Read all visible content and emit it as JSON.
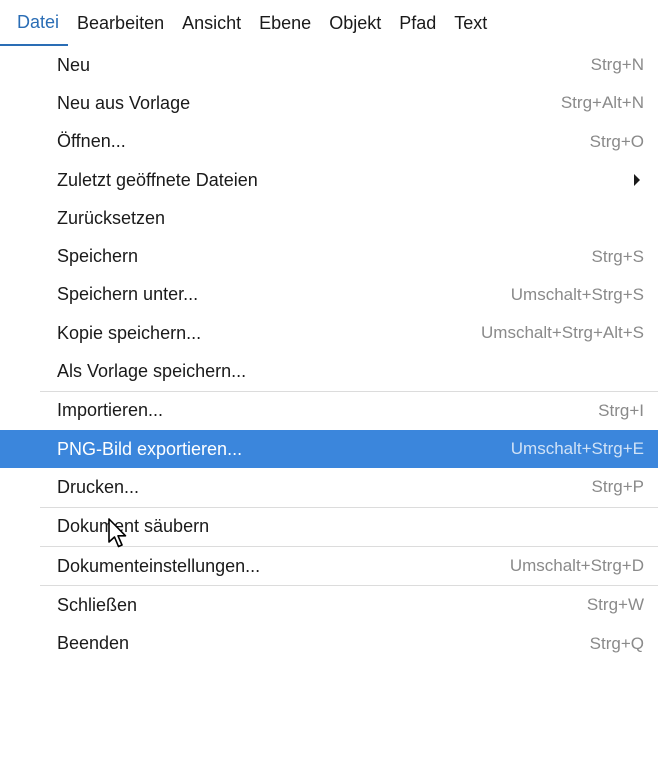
{
  "menubar": {
    "items": [
      {
        "label": "Datei",
        "active": true
      },
      {
        "label": "Bearbeiten"
      },
      {
        "label": "Ansicht"
      },
      {
        "label": "Ebene"
      },
      {
        "label": "Objekt"
      },
      {
        "label": "Pfad"
      },
      {
        "label": "Text"
      }
    ]
  },
  "menu": {
    "items": [
      {
        "label": "Neu",
        "shortcut": "Strg+N"
      },
      {
        "label": "Neu aus Vorlage",
        "shortcut": "Strg+Alt+N"
      },
      {
        "label": "Öffnen...",
        "shortcut": "Strg+O"
      },
      {
        "label": "Zuletzt geöffnete Dateien",
        "submenu": true
      },
      {
        "label": "Zurücksetzen",
        "shortcut": ""
      },
      {
        "label": "Speichern",
        "shortcut": "Strg+S"
      },
      {
        "label": "Speichern unter...",
        "shortcut": "Umschalt+Strg+S"
      },
      {
        "label": "Kopie speichern...",
        "shortcut": "Umschalt+Strg+Alt+S"
      },
      {
        "label": "Als Vorlage speichern...",
        "shortcut": ""
      },
      {
        "label": "Importieren...",
        "shortcut": "Strg+I"
      },
      {
        "label": "PNG-Bild exportieren...",
        "shortcut": "Umschalt+Strg+E",
        "highlighted": true
      },
      {
        "label": "Drucken...",
        "shortcut": "Strg+P"
      },
      {
        "label": "Dokument säubern",
        "shortcut": ""
      },
      {
        "label": "Dokumenteinstellungen...",
        "shortcut": "Umschalt+Strg+D"
      },
      {
        "label": "Schließen",
        "shortcut": "Strg+W"
      },
      {
        "label": "Beenden",
        "shortcut": "Strg+Q"
      }
    ]
  },
  "colors": {
    "accent": "#3b86dc",
    "active_menu_text": "#2a6db5",
    "shortcut_text": "#8a8a8a"
  }
}
